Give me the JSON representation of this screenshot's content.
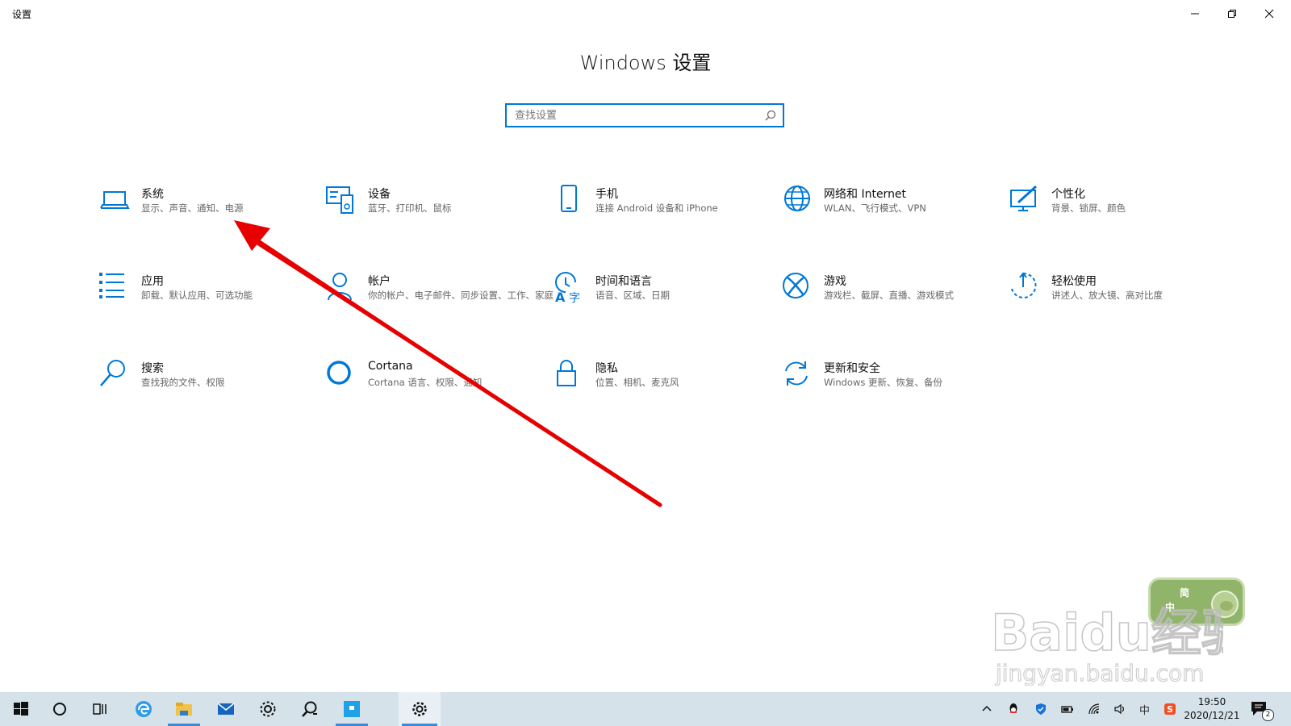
{
  "window": {
    "title": "设置",
    "minimize_icon": "minimize-icon",
    "maximize_icon": "restore-icon",
    "close_icon": "close-icon"
  },
  "header": {
    "title": "Windows 设置",
    "search_placeholder": "查找设置"
  },
  "accent_color": "#0078d7",
  "tiles": [
    {
      "icon": "laptop-icon",
      "name": "系统",
      "desc": "显示、声音、通知、电源"
    },
    {
      "icon": "keyboard-printer-icon",
      "name": "设备",
      "desc": "蓝牙、打印机、鼠标"
    },
    {
      "icon": "phone-icon",
      "name": "手机",
      "desc": "连接 Android 设备和 iPhone"
    },
    {
      "icon": "globe-icon",
      "name": "网络和 Internet",
      "desc": "WLAN、飞行模式、VPN"
    },
    {
      "icon": "paint-icon",
      "name": "个性化",
      "desc": "背景、锁屏、颜色"
    },
    {
      "icon": "apps-list-icon",
      "name": "应用",
      "desc": "卸载、默认应用、可选功能"
    },
    {
      "icon": "person-icon",
      "name": "帐户",
      "desc": "你的帐户、电子邮件、同步设置、工作、家庭"
    },
    {
      "icon": "time-language-icon",
      "name": "时间和语言",
      "desc": "语音、区域、日期"
    },
    {
      "icon": "xbox-icon",
      "name": "游戏",
      "desc": "游戏栏、截屏、直播、游戏模式"
    },
    {
      "icon": "ease-of-access-icon",
      "name": "轻松使用",
      "desc": "讲述人、放大镜、高对比度"
    },
    {
      "icon": "search-icon",
      "name": "搜索",
      "desc": "查找我的文件、权限"
    },
    {
      "icon": "cortana-icon",
      "name": "Cortana",
      "desc": "Cortana 语言、权限、通知"
    },
    {
      "icon": "lock-icon",
      "name": "隐私",
      "desc": "位置、相机、麦克风"
    },
    {
      "icon": "update-icon",
      "name": "更新和安全",
      "desc": "Windows 更新、恢复、备份"
    }
  ],
  "ime_badge": {
    "top": "简",
    "left": "中"
  },
  "watermark": {
    "line1": "Baidu经验",
    "line2": "jingyan.baidu.com"
  },
  "taskbar": {
    "items": [
      "windows-start-icon",
      "cortana-circle-icon",
      "task-view-icon",
      "edge-icon",
      "file-explorer-icon",
      "mail-icon",
      "settings-gear-icon",
      "search-app-icon",
      "app-window-icon",
      "settings-active-icon"
    ],
    "tray": [
      "chevron-up-icon",
      "qq-icon",
      "shield-icon",
      "battery-icon",
      "wifi-icon",
      "volume-icon",
      "ime-zh-icon",
      "sogou-icon"
    ],
    "ime_label": "中",
    "time": "19:50",
    "date": "2020/12/21",
    "notification_count": "2"
  }
}
